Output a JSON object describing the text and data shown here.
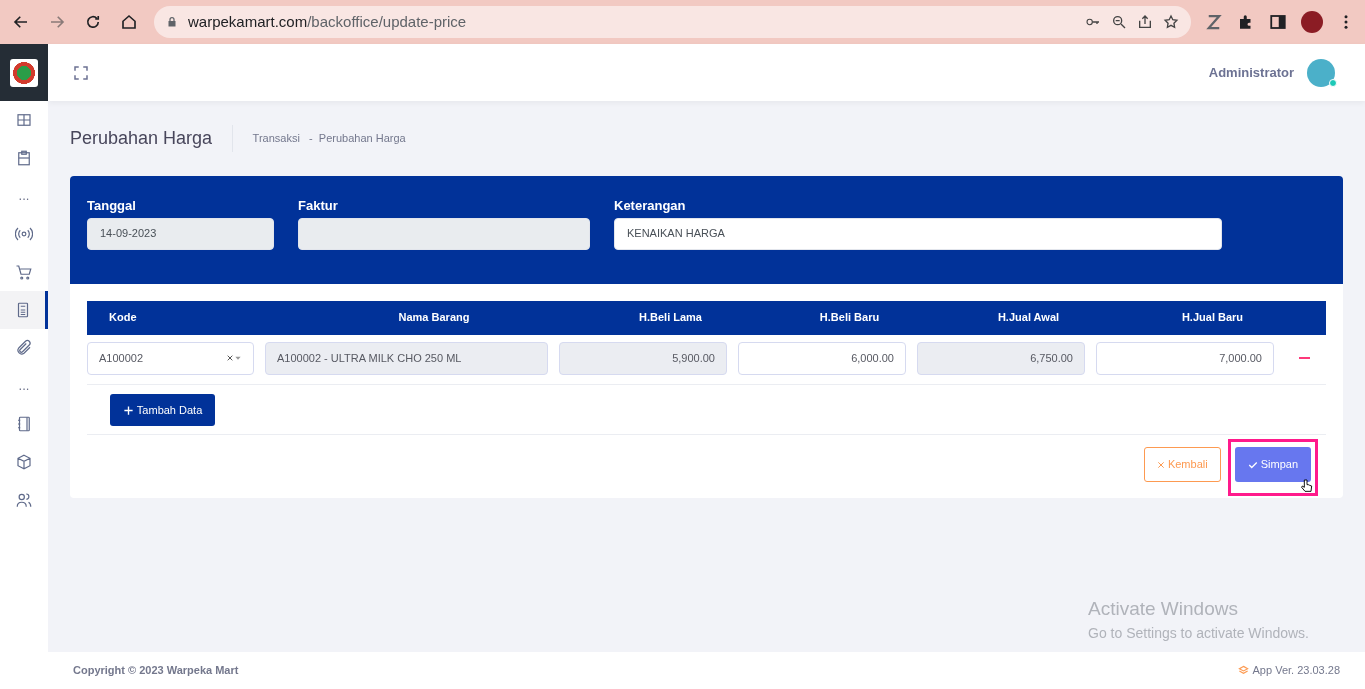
{
  "browser": {
    "url_host": "warpekamart.com",
    "url_path": "/backoffice/update-price"
  },
  "sidebar": {
    "items": [
      {
        "kind": "icon",
        "selected": false
      },
      {
        "kind": "icon",
        "selected": false
      },
      {
        "kind": "dots",
        "text": "..."
      },
      {
        "kind": "icon",
        "selected": false
      },
      {
        "kind": "icon",
        "selected": false
      },
      {
        "kind": "icon",
        "selected": true
      },
      {
        "kind": "icon",
        "selected": false
      },
      {
        "kind": "dots",
        "text": "..."
      },
      {
        "kind": "icon",
        "selected": false
      },
      {
        "kind": "icon",
        "selected": false
      },
      {
        "kind": "icon",
        "selected": false
      }
    ]
  },
  "header": {
    "user_name": "Administrator",
    "online": true
  },
  "page": {
    "title": "Perubahan Harga",
    "breadcrumb": [
      "Transaksi",
      "Perubahan Harga"
    ],
    "breadcrumb_separator": "-"
  },
  "form": {
    "fields": [
      {
        "label": "Tanggal",
        "value": "14-09-2023",
        "readonly": true
      },
      {
        "label": "Faktur",
        "readonly": true
      },
      {
        "label": "Keterangan",
        "value": "KENAIKAN HARGA",
        "readonly": false
      }
    ]
  },
  "table": {
    "columns": [
      "Kode",
      "Nama Barang",
      "H.Beli Lama",
      "H.Beli Baru",
      "H.Jual Awal",
      "H.Jual Baru"
    ],
    "rows": [
      {
        "kode": "A100002",
        "nama_barang": "A100002 - ULTRA MILK CHO 250 ML",
        "h_beli_lama": "5,900.00",
        "h_beli_baru": "6,000.00",
        "h_jual_awal": "6,750.00",
        "h_jual_baru": "7,000.00"
      }
    ]
  },
  "add_button": "Tambah Data",
  "actions": {
    "cancel": "Kembali",
    "save": "Simpan",
    "save_highlighted": true
  },
  "watermark_os": {
    "title": "Activate Windows",
    "subtitle": "Go to Settings to activate Windows."
  },
  "footer": {
    "copyright": "Copyright © 2023 Warpeka Mart",
    "version": "App Ver. 23.03.28"
  }
}
